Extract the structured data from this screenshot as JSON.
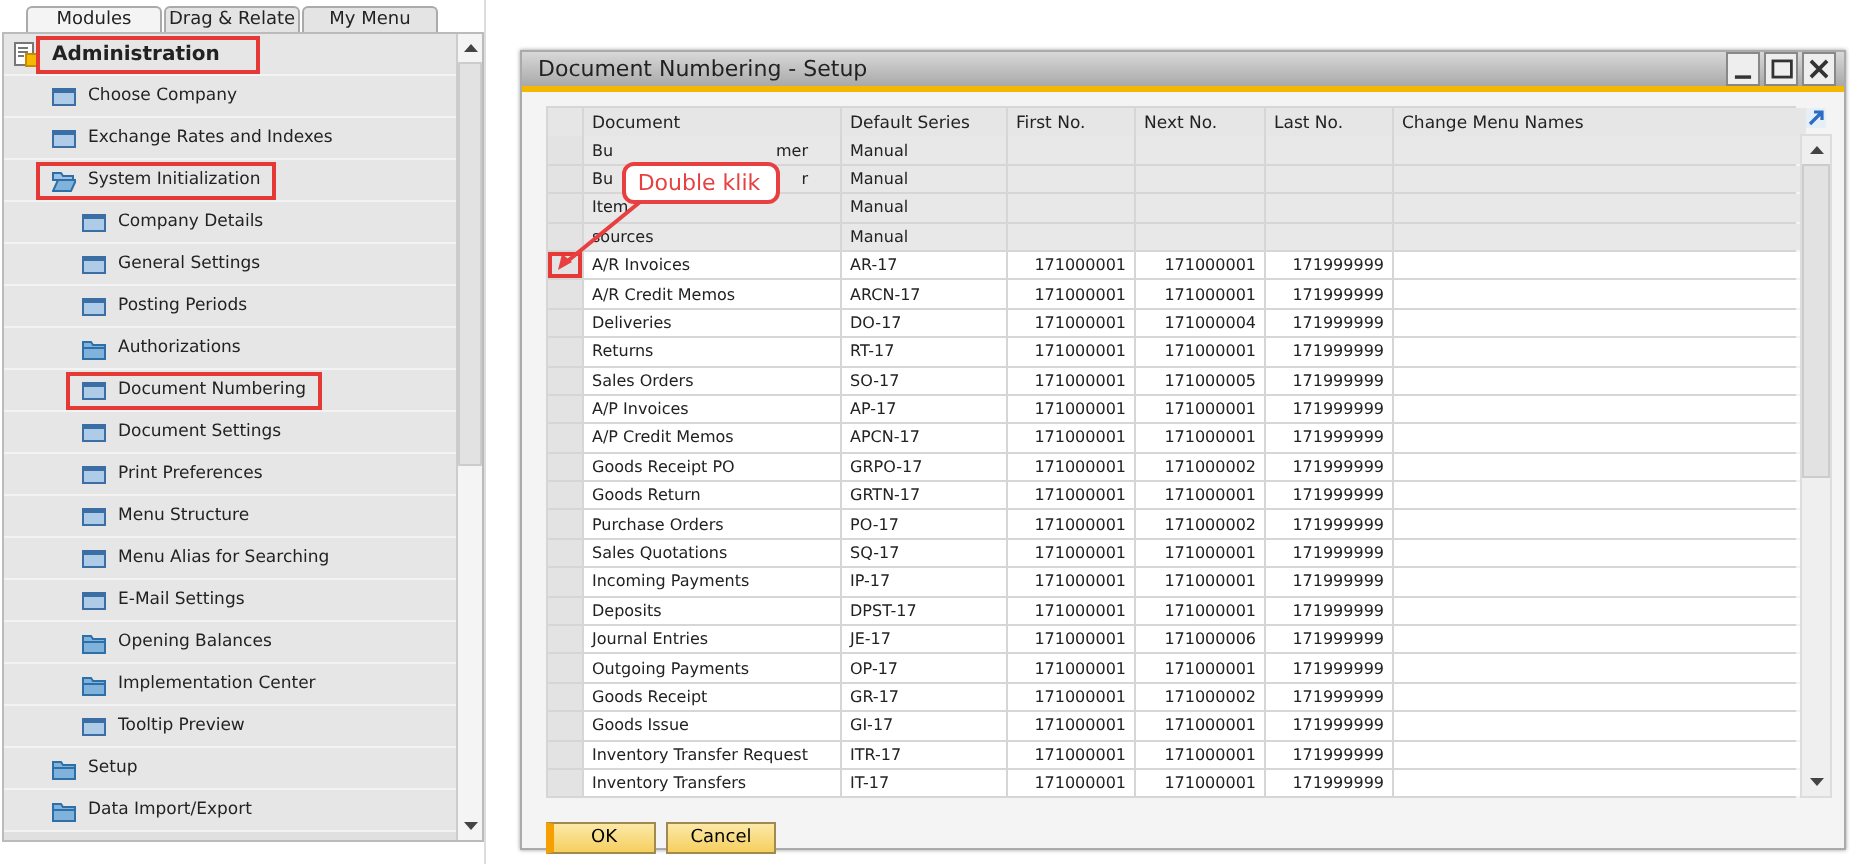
{
  "menu_tabs": [
    {
      "label": "Modules",
      "selected": true
    },
    {
      "label": "Drag & Relate",
      "selected": false
    },
    {
      "label": "My Menu",
      "selected": false
    }
  ],
  "tree": [
    {
      "label": "Administration",
      "kind": "module",
      "highlighted": true,
      "children": [
        {
          "label": "Choose Company",
          "kind": "window",
          "highlighted": false
        },
        {
          "label": "Exchange Rates and Indexes",
          "kind": "window",
          "highlighted": false
        },
        {
          "label": "System Initialization",
          "kind": "folder",
          "expanded": true,
          "highlighted": true,
          "children": [
            {
              "label": "Company Details",
              "kind": "window",
              "highlighted": false
            },
            {
              "label": "General Settings",
              "kind": "window",
              "highlighted": false
            },
            {
              "label": "Posting Periods",
              "kind": "window",
              "highlighted": false
            },
            {
              "label": "Authorizations",
              "kind": "folder",
              "expanded": false,
              "highlighted": false
            },
            {
              "label": "Document Numbering",
              "kind": "window",
              "highlighted": true
            },
            {
              "label": "Document Settings",
              "kind": "window",
              "highlighted": false
            },
            {
              "label": "Print Preferences",
              "kind": "window",
              "highlighted": false
            },
            {
              "label": "Menu Structure",
              "kind": "window",
              "highlighted": false
            },
            {
              "label": "Menu Alias for Searching",
              "kind": "window",
              "highlighted": false
            },
            {
              "label": "E-Mail Settings",
              "kind": "window",
              "highlighted": false
            },
            {
              "label": "Opening Balances",
              "kind": "folder",
              "expanded": false,
              "highlighted": false
            },
            {
              "label": "Implementation Center",
              "kind": "folder",
              "expanded": false,
              "highlighted": false
            },
            {
              "label": "Tooltip Preview",
              "kind": "window",
              "highlighted": false
            }
          ]
        },
        {
          "label": "Setup",
          "kind": "folder",
          "expanded": false,
          "highlighted": false
        },
        {
          "label": "Data Import/Export",
          "kind": "folder",
          "expanded": false,
          "highlighted": false
        }
      ]
    }
  ],
  "window": {
    "title": "Document Numbering - Setup",
    "table": {
      "columns": [
        "Document",
        "Default Series",
        "First No.",
        "Next No.",
        "Last No.",
        "Change Menu Names"
      ],
      "rows": [
        {
          "document": [
            "Bu",
            "mer"
          ],
          "series": "Manual",
          "locked": true,
          "marked": false
        },
        {
          "document": [
            "Bu",
            "r"
          ],
          "series": "Manual",
          "locked": true,
          "marked": false
        },
        {
          "document": [
            "Item"
          ],
          "series": "Manual",
          "locked": true,
          "marked": false
        },
        {
          "document": [
            "sources"
          ],
          "series": "Manual",
          "locked": true,
          "marked": false
        },
        {
          "document": [
            "A/R Invoices"
          ],
          "series": "AR-17",
          "first": "171000001",
          "next": "171000001",
          "last": "171999999",
          "locked": false,
          "marked": true
        },
        {
          "document": [
            "A/R Credit Memos"
          ],
          "series": "ARCN-17",
          "first": "171000001",
          "next": "171000001",
          "last": "171999999",
          "locked": false,
          "marked": false
        },
        {
          "document": [
            "Deliveries"
          ],
          "series": "DO-17",
          "first": "171000001",
          "next": "171000004",
          "last": "171999999",
          "locked": false,
          "marked": false
        },
        {
          "document": [
            "Returns"
          ],
          "series": "RT-17",
          "first": "171000001",
          "next": "171000001",
          "last": "171999999",
          "locked": false,
          "marked": false
        },
        {
          "document": [
            "Sales Orders"
          ],
          "series": "SO-17",
          "first": "171000001",
          "next": "171000005",
          "last": "171999999",
          "locked": false,
          "marked": false
        },
        {
          "document": [
            "A/P Invoices"
          ],
          "series": "AP-17",
          "first": "171000001",
          "next": "171000001",
          "last": "171999999",
          "locked": false,
          "marked": false
        },
        {
          "document": [
            "A/P Credit Memos"
          ],
          "series": "APCN-17",
          "first": "171000001",
          "next": "171000001",
          "last": "171999999",
          "locked": false,
          "marked": false
        },
        {
          "document": [
            "Goods Receipt PO"
          ],
          "series": "GRPO-17",
          "first": "171000001",
          "next": "171000002",
          "last": "171999999",
          "locked": false,
          "marked": false
        },
        {
          "document": [
            "Goods Return"
          ],
          "series": "GRTN-17",
          "first": "171000001",
          "next": "171000001",
          "last": "171999999",
          "locked": false,
          "marked": false
        },
        {
          "document": [
            "Purchase Orders"
          ],
          "series": "PO-17",
          "first": "171000001",
          "next": "171000002",
          "last": "171999999",
          "locked": false,
          "marked": false
        },
        {
          "document": [
            "Sales Quotations"
          ],
          "series": "SQ-17",
          "first": "171000001",
          "next": "171000001",
          "last": "171999999",
          "locked": false,
          "marked": false
        },
        {
          "document": [
            "Incoming Payments"
          ],
          "series": "IP-17",
          "first": "171000001",
          "next": "171000001",
          "last": "171999999",
          "locked": false,
          "marked": false
        },
        {
          "document": [
            "Deposits"
          ],
          "series": "DPST-17",
          "first": "171000001",
          "next": "171000001",
          "last": "171999999",
          "locked": false,
          "marked": false
        },
        {
          "document": [
            "Journal Entries"
          ],
          "series": "JE-17",
          "first": "171000001",
          "next": "171000006",
          "last": "171999999",
          "locked": false,
          "marked": false
        },
        {
          "document": [
            "Outgoing Payments"
          ],
          "series": "OP-17",
          "first": "171000001",
          "next": "171000001",
          "last": "171999999",
          "locked": false,
          "marked": false
        },
        {
          "document": [
            "Goods Receipt"
          ],
          "series": "GR-17",
          "first": "171000001",
          "next": "171000002",
          "last": "171999999",
          "locked": false,
          "marked": false
        },
        {
          "document": [
            "Goods Issue"
          ],
          "series": "GI-17",
          "first": "171000001",
          "next": "171000001",
          "last": "171999999",
          "locked": false,
          "marked": false
        },
        {
          "document": [
            "Inventory Transfer Request"
          ],
          "series": "ITR-17",
          "first": "171000001",
          "next": "171000001",
          "last": "171999999",
          "locked": false,
          "marked": false
        },
        {
          "document": [
            "Inventory Transfers"
          ],
          "series": "IT-17",
          "first": "171000001",
          "next": "171000001",
          "last": "171999999",
          "locked": false,
          "marked": false
        }
      ]
    },
    "buttons": [
      "OK",
      "Cancel"
    ]
  },
  "callout": {
    "text": "Double klik"
  }
}
